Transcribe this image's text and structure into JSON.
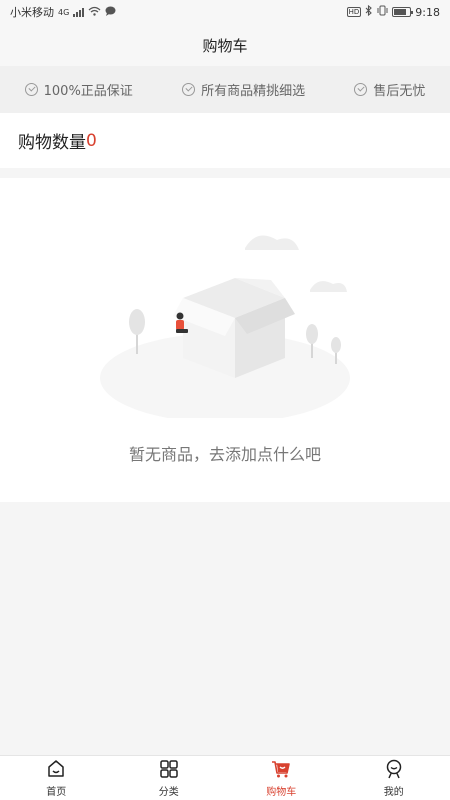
{
  "status_bar": {
    "carrier": "小米移动",
    "network": "4G",
    "time": "9:18",
    "hd": "HD"
  },
  "header": {
    "title": "购物车"
  },
  "guarantees": [
    {
      "label": "100%正品保证"
    },
    {
      "label": "所有商品精挑细选"
    },
    {
      "label": "售后无忧"
    }
  ],
  "cart": {
    "count_label": "购物数量",
    "count": "0"
  },
  "empty": {
    "message": "暂无商品，去添加点什么吧"
  },
  "bottom_nav": {
    "items": [
      {
        "label": "首页",
        "icon": "home-icon"
      },
      {
        "label": "分类",
        "icon": "grid-icon"
      },
      {
        "label": "购物车",
        "icon": "cart-icon",
        "active": true
      },
      {
        "label": "我的",
        "icon": "user-icon"
      }
    ]
  },
  "colors": {
    "accent": "#d8412f",
    "page_bg": "#f5f5f5",
    "card_bg": "#ffffff"
  }
}
